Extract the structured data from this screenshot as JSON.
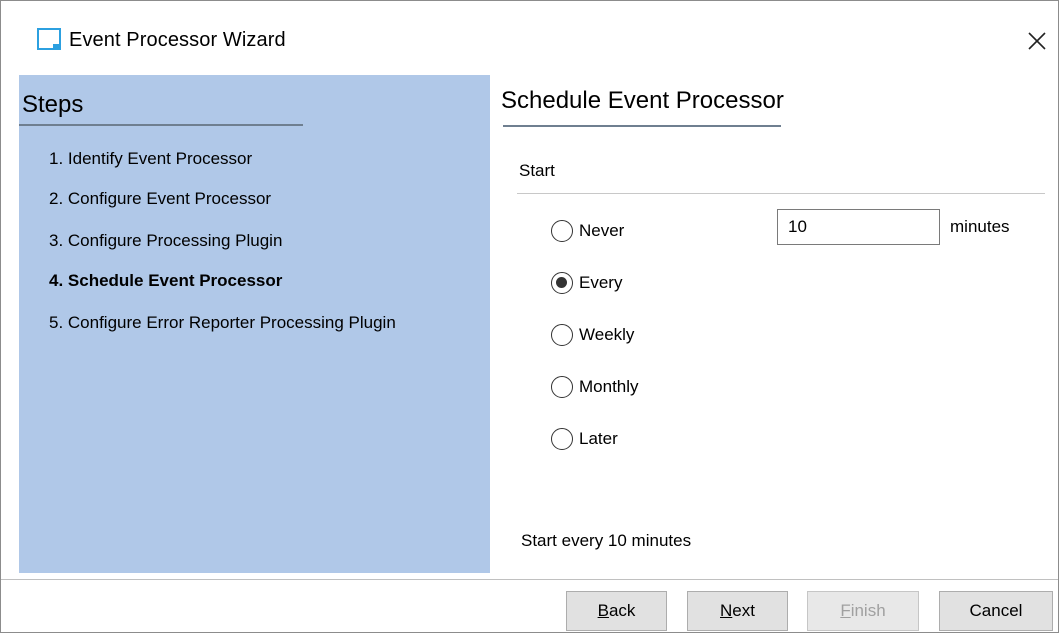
{
  "window": {
    "title": "Event Processor Wizard",
    "close_icon": "close-icon"
  },
  "steps": {
    "title": "Steps",
    "items": [
      {
        "label": "1. Identify Event Processor",
        "current": false
      },
      {
        "label": "2. Configure Event Processor",
        "current": false
      },
      {
        "label": "3. Configure Processing Plugin",
        "current": false
      },
      {
        "label": "4. Schedule Event Processor",
        "current": true
      },
      {
        "label": "5. Configure Error Reporter Processing Plugin",
        "current": false
      }
    ]
  },
  "schedule": {
    "title": "Schedule Event Processor",
    "start_label": "Start",
    "options": [
      {
        "label": "Never",
        "checked": false
      },
      {
        "label": "Every",
        "checked": true
      },
      {
        "label": "Weekly",
        "checked": false
      },
      {
        "label": "Monthly",
        "checked": false
      },
      {
        "label": "Later",
        "checked": false
      }
    ],
    "interval_value": "10",
    "interval_unit": "minutes",
    "summary": "Start every 10 minutes"
  },
  "buttons": {
    "back": {
      "mnemonic": "B",
      "rest": "ack",
      "enabled": true
    },
    "next": {
      "mnemonic": "N",
      "rest": "ext",
      "enabled": true
    },
    "finish": {
      "mnemonic": "F",
      "rest": "inish",
      "enabled": false
    },
    "cancel": {
      "label": "Cancel",
      "enabled": true
    }
  },
  "colors": {
    "steps_panel": "#b0c8e8",
    "icon_accent": "#2ca0e0"
  }
}
